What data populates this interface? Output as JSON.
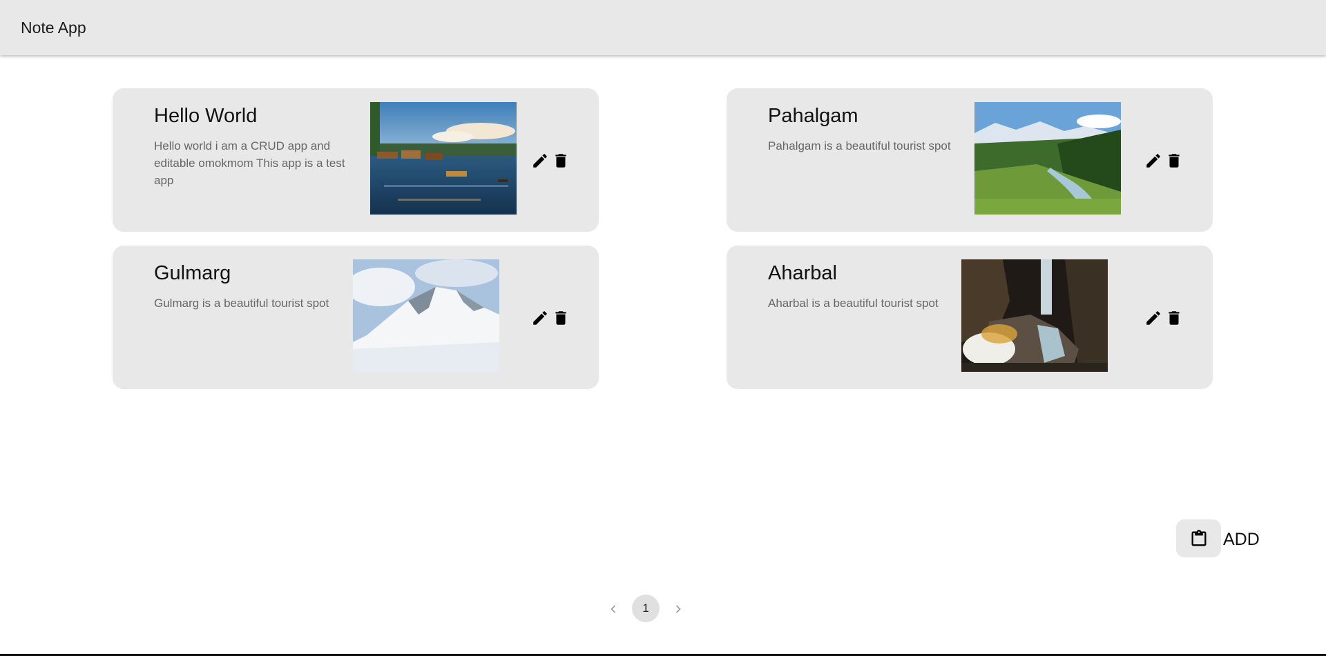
{
  "app": {
    "title": "Note App"
  },
  "notes": [
    {
      "title": "Hello World",
      "description": "Hello world i am a CRUD app and editable omokmom This app is a test app",
      "image": "dal-lake-houseboats-photo",
      "edit_icon": "pencil-icon",
      "delete_icon": "trash-icon"
    },
    {
      "title": "Pahalgam",
      "description": "Pahalgam is a beautiful tourist spot",
      "image": "pahalgam-valley-photo",
      "edit_icon": "pencil-icon",
      "delete_icon": "trash-icon"
    },
    {
      "title": "Gulmarg",
      "description": "Gulmarg is a beautiful tourist spot",
      "image": "gulmarg-snow-mountain-photo",
      "edit_icon": "pencil-icon",
      "delete_icon": "trash-icon"
    },
    {
      "title": "Aharbal",
      "description": "Aharbal is a beautiful tourist spot",
      "image": "aharbal-waterfall-photo",
      "edit_icon": "pencil-icon",
      "delete_icon": "trash-icon"
    }
  ],
  "add": {
    "label": "ADD",
    "icon": "clipboard-icon"
  },
  "pagination": {
    "current_page": "1",
    "prev_icon": "chevron-left-icon",
    "next_icon": "chevron-right-icon"
  },
  "colors": {
    "appbar": "#e8e8e8",
    "card": "#e8e8e8",
    "description": "#666666",
    "page_active": "#e0e0e0"
  }
}
